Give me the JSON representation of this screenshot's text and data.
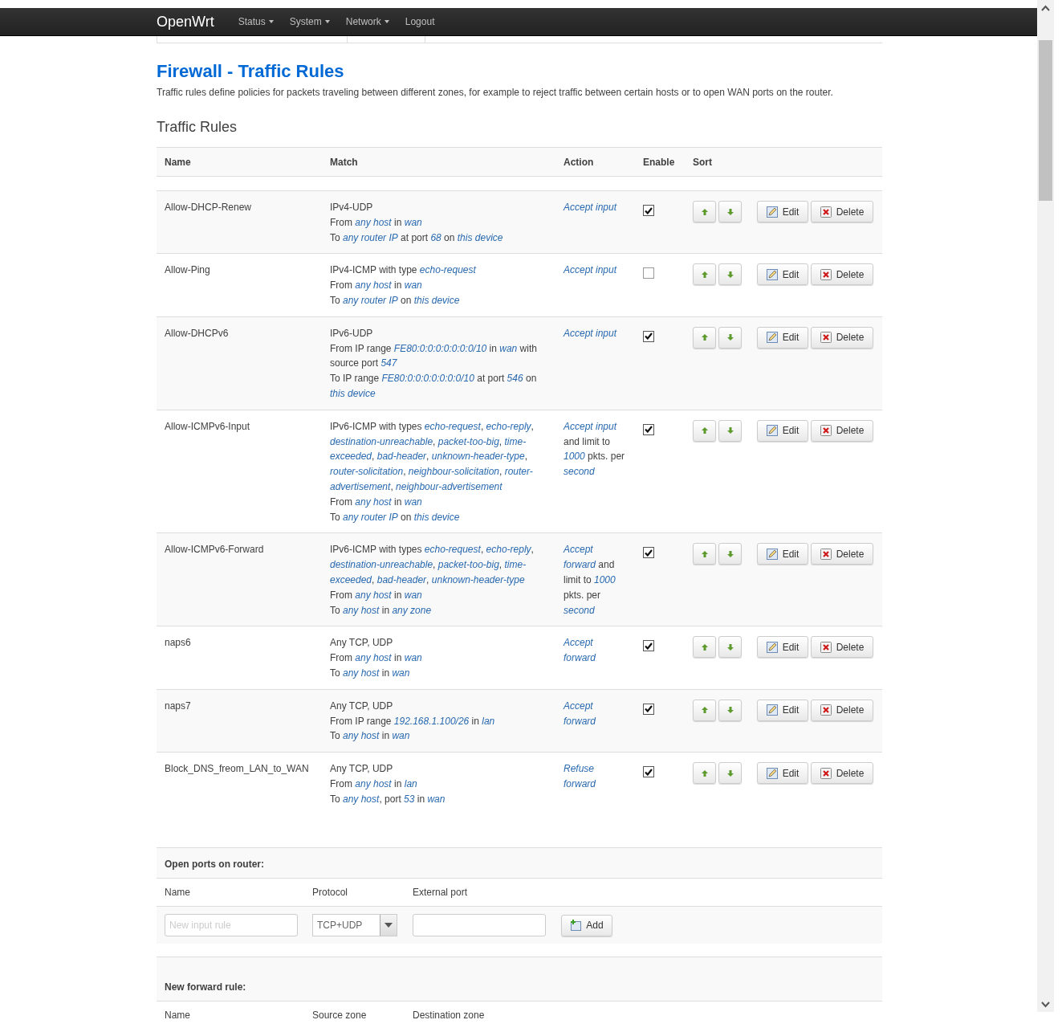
{
  "navbar": {
    "brand": "OpenWrt",
    "menu": [
      {
        "label": "Status",
        "dropdown": true
      },
      {
        "label": "System",
        "dropdown": true
      },
      {
        "label": "Network",
        "dropdown": true
      },
      {
        "label": "Logout",
        "dropdown": false
      }
    ]
  },
  "page": {
    "title": "Firewall - Traffic Rules",
    "description": "Traffic rules define policies for packets traveling between different zones, for example to reject traffic between certain hosts or to open WAN ports on the router."
  },
  "rules_section": {
    "title": "Traffic Rules",
    "columns": [
      "Name",
      "Match",
      "Action",
      "Enable",
      "Sort"
    ],
    "rows": [
      {
        "name": "Allow-DHCP-Renew",
        "match": [
          "IPv4-UDP",
          "From *any host* in *wan*",
          "To *any router IP* at port *68* on *this device*"
        ],
        "action": "*Accept input*",
        "enabled": true,
        "edit": "Edit",
        "delete": "Delete"
      },
      {
        "name": "Allow-Ping",
        "match": [
          "IPv4-ICMP with type *echo-request*",
          "From *any host* in *wan*",
          "To *any router IP* on *this device*"
        ],
        "action": "*Accept input*",
        "enabled": false,
        "edit": "Edit",
        "delete": "Delete"
      },
      {
        "name": "Allow-DHCPv6",
        "match": [
          "IPv6-UDP",
          "From IP range *FE80:0:0:0:0:0:0:0/10* in *wan* with source port *547*",
          "To IP range *FE80:0:0:0:0:0:0:0/10* at port *546* on *this device*"
        ],
        "action": "*Accept input*",
        "enabled": true,
        "edit": "Edit",
        "delete": "Delete"
      },
      {
        "name": "Allow-ICMPv6-Input",
        "match": [
          "IPv6-ICMP with types *echo-request*, *echo-reply*, *destination-unreachable*, *packet-too-big*, *time-exceeded*, *bad-header*, *unknown-header-type*, *router-solicitation*, *neighbour-solicitation*, *router-advertisement*, *neighbour-advertisement*",
          "From *any host* in *wan*",
          "To *any router IP* on *this device*"
        ],
        "action": "*Accept input* and limit to *1000* pkts. per *second*",
        "enabled": true,
        "edit": "Edit",
        "delete": "Delete"
      },
      {
        "name": "Allow-ICMPv6-Forward",
        "match": [
          "IPv6-ICMP with types *echo-request*, *echo-reply*, *destination-unreachable*, *packet-too-big*, *time-exceeded*, *bad-header*, *unknown-header-type*",
          "From *any host* in *wan*",
          "To *any host* in *any zone*"
        ],
        "action": "*Accept forward* and limit to *1000* pkts. per *second*",
        "enabled": true,
        "edit": "Edit",
        "delete": "Delete"
      },
      {
        "name": "naps6",
        "match": [
          "Any TCP, UDP",
          "From *any host* in *wan*",
          "To *any host* in *wan*"
        ],
        "action": "*Accept forward*",
        "enabled": true,
        "edit": "Edit",
        "delete": "Delete"
      },
      {
        "name": "naps7",
        "match": [
          "Any TCP, UDP",
          "From IP range *192.168.1.100/26* in *lan*",
          "To *any host* in *wan*"
        ],
        "action": "*Accept forward*",
        "enabled": true,
        "edit": "Edit",
        "delete": "Delete"
      },
      {
        "name": "Block_DNS_freom_LAN_to_WAN",
        "match": [
          "Any TCP, UDP",
          "From *any host* in *lan*",
          "To *any host*, port *53* in *wan*"
        ],
        "action": "*Refuse forward*",
        "enabled": true,
        "edit": "Edit",
        "delete": "Delete"
      }
    ]
  },
  "open_ports": {
    "title": "Open ports on router:",
    "columns": [
      "Name",
      "Protocol",
      "External port"
    ],
    "name_placeholder": "New input rule",
    "protocol": "TCP+UDP",
    "add_button": "Add"
  },
  "new_forward": {
    "title": "New forward rule:",
    "columns": [
      "Name",
      "Source zone",
      "Destination zone"
    ]
  }
}
